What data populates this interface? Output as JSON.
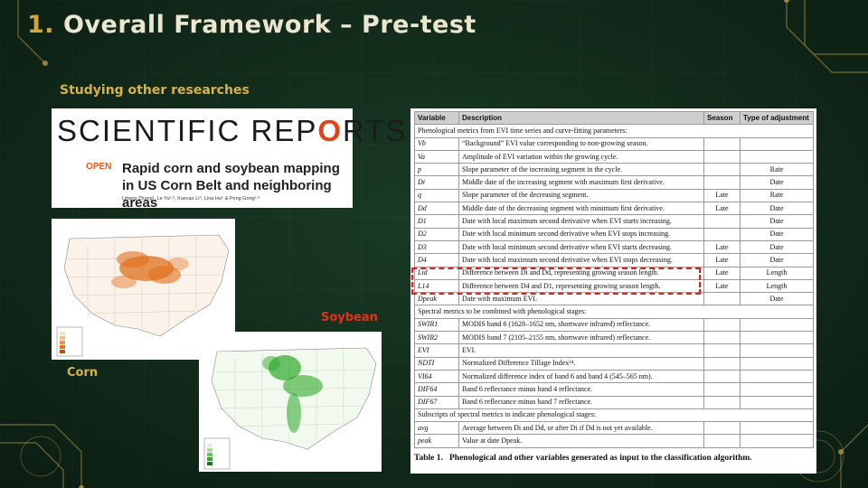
{
  "slide": {
    "title_num": "1.",
    "title_text": "Overall Framework – Pre-test",
    "subtitle": "Studying other researches"
  },
  "paper": {
    "journal_left": "SCIENTIFIC REP",
    "journal_gear": "O",
    "journal_right": "RTS",
    "open_label": "OPEN",
    "article_title": "Rapid corn and soybean mapping in US Corn Belt and neighboring areas",
    "authors": "Liheng Zhong¹, Le Yu²·³, Xuecao Li⁴, Lina Hu⁵ & Peng Gong²·³"
  },
  "maps": {
    "corn_label": "Corn",
    "soybean_label": "Soybean",
    "corn_colors": {
      "low": "#f6e2c8",
      "high": "#e0701d"
    },
    "soy_colors": {
      "low": "#dff2d8",
      "high": "#2ea82a"
    }
  },
  "table": {
    "headers": [
      "Variable",
      "Description",
      "Season",
      "Type of adjustment"
    ],
    "rows": [
      {
        "section": "Phenological metrics from EVI time series and curve-fitting parameters:"
      },
      {
        "var": "Vb",
        "desc": "“Background” EVI value corresponding to non-growing season.",
        "season": "",
        "adj": ""
      },
      {
        "var": "Va",
        "desc": "Amplitude of EVI variation within the growing cycle.",
        "season": "",
        "adj": ""
      },
      {
        "var": "p",
        "desc": "Slope parameter of the increasing segment in the cycle.",
        "season": "",
        "adj": "Rate"
      },
      {
        "var": "Di",
        "desc": "Middle date of the increasing segment with maximum first derivative.",
        "season": "",
        "adj": "Date"
      },
      {
        "var": "q",
        "desc": "Slope parameter of the decreasing segment.",
        "season": "Late",
        "adj": "Rate"
      },
      {
        "var": "Dd",
        "desc": "Middle date of the decreasing segment with minimum first derivative.",
        "season": "Late",
        "adj": "Date"
      },
      {
        "var": "D1",
        "desc": "Date with local maximum second derivative when EVI starts increasing.",
        "season": "",
        "adj": "Date"
      },
      {
        "var": "D2",
        "desc": "Date with local minimum second derivative when EVI stops increasing.",
        "season": "",
        "adj": "Date"
      },
      {
        "var": "D3",
        "desc": "Date with local minimum second derivative when EVI starts decreasing.",
        "season": "Late",
        "adj": "Date"
      },
      {
        "var": "D4",
        "desc": "Date with local maximum second derivative when EVI stops decreasing.",
        "season": "Late",
        "adj": "Date"
      },
      {
        "var": "Lid",
        "desc": "Difference between Di and Dd, representing growing season length.",
        "season": "Late",
        "adj": "Length"
      },
      {
        "var": "L14",
        "desc": "Difference between D4 and D1, representing growing season length.",
        "season": "Late",
        "adj": "Length"
      },
      {
        "var": "Dpeak",
        "desc": "Date with maximum EVI.",
        "season": "",
        "adj": "Date"
      },
      {
        "section": "Spectral metrics to be combined with phenological stages:"
      },
      {
        "var": "SWIR1",
        "desc": "MODIS band 6 (1628–1652 nm, shortwave infrared) reflectance.",
        "season": "",
        "adj": ""
      },
      {
        "var": "SWIR2",
        "desc": "MODIS band 7 (2105–2155 nm, shortwave infrared) reflectance.",
        "season": "",
        "adj": ""
      },
      {
        "var": "EVI",
        "desc": "EVI.",
        "season": "",
        "adj": ""
      },
      {
        "var": "NDTI",
        "desc": "Normalized Difference Tillage Index²⁴.",
        "season": "",
        "adj": ""
      },
      {
        "var": "VI64",
        "desc": "Normalized difference index of band 6 and band 4 (545–565 nm).",
        "season": "",
        "adj": ""
      },
      {
        "var": "DIF64",
        "desc": "Band 6 reflectance minus band 4 reflectance.",
        "season": "",
        "adj": ""
      },
      {
        "var": "DIF67",
        "desc": "Band 6 reflectance minus band 7 reflectance.",
        "season": "",
        "adj": ""
      },
      {
        "section": "Subscripts of spectral metrics to indicate phenological stages:"
      },
      {
        "var": "avg",
        "desc": "Average between Di and Dd, or after Di if Dd is not yet available.",
        "season": "",
        "adj": ""
      },
      {
        "var": "peak",
        "desc": "Value at date Dpeak.",
        "season": "",
        "adj": ""
      }
    ],
    "caption_num": "Table 1.",
    "caption_text": "Phenological and other variables generated as input to the classification algorithm."
  },
  "colors": {
    "accent_gold": "#d4a838",
    "accent_red": "#d9221c",
    "background": "#13301f"
  }
}
